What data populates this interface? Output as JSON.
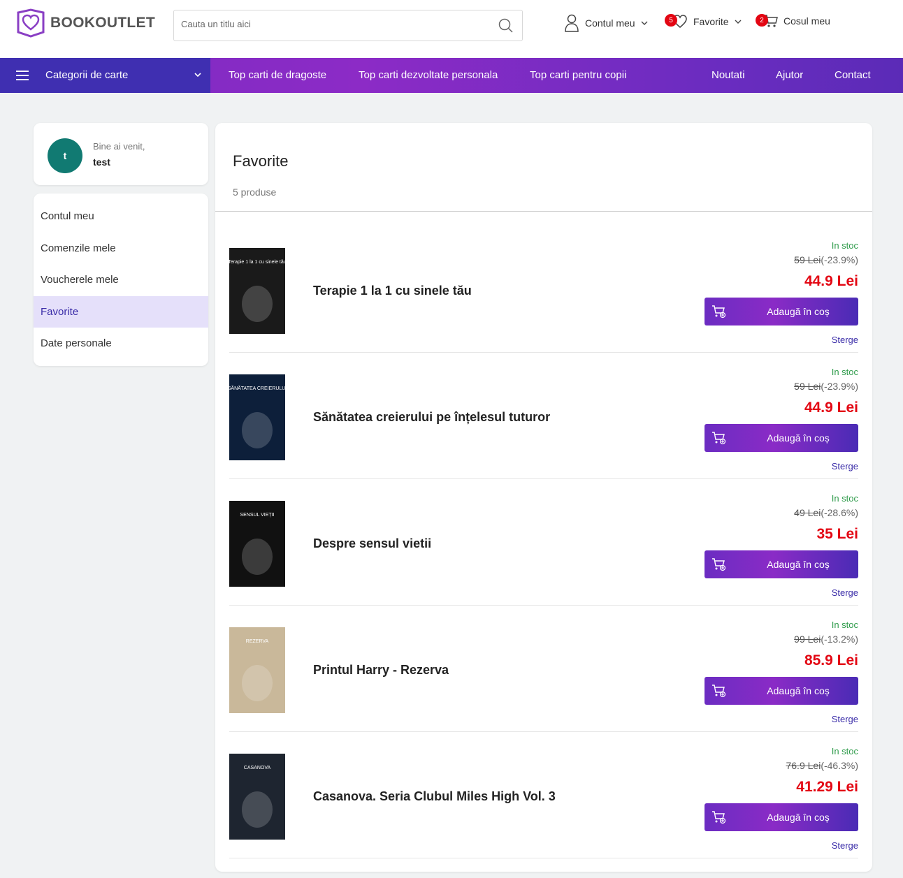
{
  "header": {
    "logo_text": "BOOKOUTLET",
    "search_placeholder": "Cauta un titlu aici",
    "account_label": "Contul meu",
    "favorites_label": "Favorite",
    "favorites_count": "5",
    "cart_label": "Cosul meu",
    "cart_count": "2"
  },
  "nav": {
    "categories_label": "Categorii de carte",
    "links": [
      "Top carti de dragoste",
      "Top carti dezvoltate personala",
      "Top carti pentru copii",
      "Noutati",
      "Ajutor",
      "Contact"
    ]
  },
  "sidebar": {
    "greeting": "Bine ai venit,",
    "username": "test",
    "avatar_letter": "t",
    "menu": [
      "Contul meu",
      "Comenzile mele",
      "Voucherele mele",
      "Favorite",
      "Date personale"
    ],
    "active_index": 3
  },
  "main": {
    "title": "Favorite",
    "count_text": "5 produse",
    "products": [
      {
        "name": "Terapie 1 la 1 cu sinele tău",
        "stock": "In stoc",
        "old_price": "59 Lei",
        "discount": "(-23.9%)",
        "price": "44.9 Lei",
        "add_label": "Adaugă în coș",
        "remove_label": "Sterge",
        "cover_color": "#1a1a1a",
        "cover_text": "Terapie 1 la 1 cu sinele tău"
      },
      {
        "name": "Sănătatea creierului pe înțelesul tuturor",
        "stock": "In stoc",
        "old_price": "59 Lei",
        "discount": "(-23.9%)",
        "price": "44.9 Lei",
        "add_label": "Adaugă în coș",
        "remove_label": "Sterge",
        "cover_color": "#0d1f3a",
        "cover_text": "SĂNĂTATEA CREIERULUI"
      },
      {
        "name": "Despre sensul vietii",
        "stock": "In stoc",
        "old_price": "49 Lei",
        "discount": "(-28.6%)",
        "price": "35 Lei",
        "add_label": "Adaugă în coș",
        "remove_label": "Sterge",
        "cover_color": "#111111",
        "cover_text": "SENSUL VIEȚII"
      },
      {
        "name": "Printul Harry - Rezerva",
        "stock": "In stoc",
        "old_price": "99 Lei",
        "discount": "(-13.2%)",
        "price": "85.9 Lei",
        "add_label": "Adaugă în coș",
        "remove_label": "Sterge",
        "cover_color": "#c9b89a",
        "cover_text": "REZERVA"
      },
      {
        "name": "Casanova. Seria Clubul Miles High Vol. 3",
        "stock": "In stoc",
        "old_price": "76.9 Lei",
        "discount": "(-46.3%)",
        "price": "41.29 Lei",
        "add_label": "Adaugă în coș",
        "remove_label": "Sterge",
        "cover_color": "#1e2530",
        "cover_text": "CASANOVA"
      }
    ]
  },
  "colors": {
    "brand_purple": "#3f2fb1",
    "price_red": "#e30613",
    "stock_green": "#2e9b4a",
    "active_menu_bg": "#e5e0fa"
  }
}
